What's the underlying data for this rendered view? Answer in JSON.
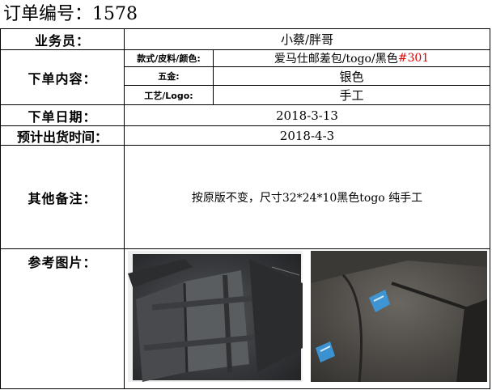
{
  "title": "订单编号：1578",
  "rows": {
    "salesperson": {
      "label": "业务员：",
      "value": "小蔡/胖哥"
    },
    "order_content": {
      "label": "下单内容：",
      "items": [
        {
          "label": "款式/皮料/颜色:",
          "value": "爱马仕邮差包/togo/黑色",
          "value_code": "#301"
        },
        {
          "label": "五金:",
          "value": "银色"
        },
        {
          "label": "工艺/Logo:",
          "value": "手工"
        }
      ]
    },
    "order_date": {
      "label": "下单日期：",
      "value": "2018-3-13"
    },
    "ship_date": {
      "label": "预计出货时间：",
      "value": "2018-4-3"
    },
    "remarks": {
      "label": "其他备注：",
      "value": "按原版不变，尺寸32*24*10黑色togo 纯手工"
    },
    "reference": {
      "label": "参考图片："
    }
  },
  "colors": {
    "code_highlight": "#e00000",
    "leather": "#3a3c3e",
    "tag": "#3b9be0"
  }
}
